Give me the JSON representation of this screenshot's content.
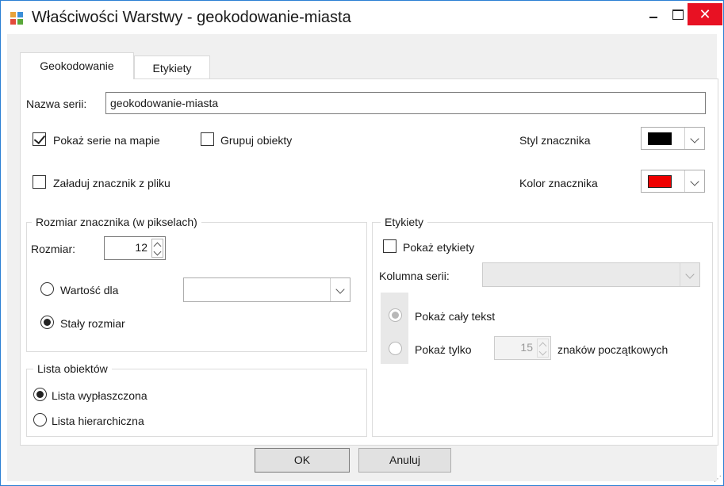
{
  "window": {
    "title": "Właściwości Warstwy - geokodowanie-miasta",
    "close_symbol": "✕"
  },
  "tabs": [
    {
      "label": "Geokodowanie",
      "active": true
    },
    {
      "label": "Etykiety",
      "active": false
    }
  ],
  "series_name": {
    "label": "Nazwa serii:",
    "value": "geokodowanie-miasta"
  },
  "options": {
    "show_series": {
      "label": "Pokaż serie na mapie",
      "checked": true
    },
    "group_objects": {
      "label": "Grupuj obiekty",
      "checked": false
    },
    "load_marker": {
      "label": "Załaduj znacznik z pliku",
      "checked": false
    }
  },
  "marker": {
    "style_label": "Styl znacznika",
    "style_color": "#000000",
    "color_label": "Kolor znacznika",
    "color_value": "#ee0000"
  },
  "size_group": {
    "title": "Rozmiar znacznika (w pikselach)",
    "size_label": "Rozmiar:",
    "size_value": "12",
    "value_for_label": "Wartość dla",
    "value_for_selected": "",
    "fixed_size_label": "Stały rozmiar",
    "selected_mode": "fixed"
  },
  "objects_group": {
    "title": "Lista obiektów",
    "flat_label": "Lista wypłaszczona",
    "hier_label": "Lista hierarchiczna",
    "selected": "flat"
  },
  "labels_group": {
    "title": "Etykiety",
    "show_labels": "Pokaż etykiety",
    "show_labels_checked": false,
    "column_label": "Kolumna serii:",
    "column_value": "",
    "show_full_text": "Pokaż cały tekst",
    "show_only": "Pokaż tylko",
    "chars_value": "15",
    "chars_suffix": "znaków początkowych"
  },
  "buttons": {
    "ok": "OK",
    "cancel": "Anuluj"
  },
  "grip": "⋰"
}
